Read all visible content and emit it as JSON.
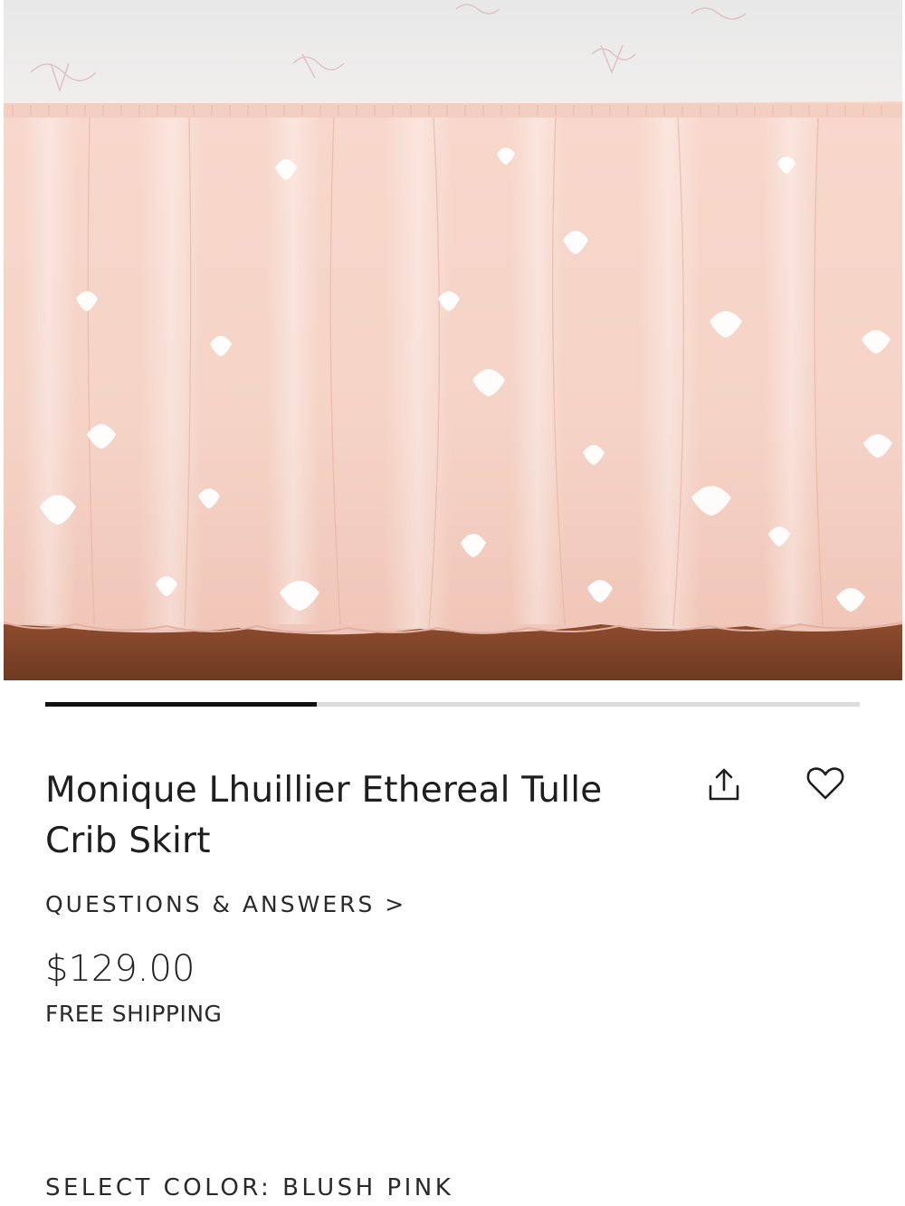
{
  "product": {
    "title": "Monique Lhuillier Ethereal Tulle Crib Skirt",
    "questions_link": "QUESTIONS & ANSWERS >",
    "price": "$129.00",
    "shipping": "FREE SHIPPING",
    "color_selector_label": "SELECT COLOR: BLUSH PINK"
  },
  "gallery": {
    "progress_fraction": 0.333
  },
  "icons": {
    "share": "share-icon",
    "favorite": "heart-icon"
  },
  "colors": {
    "accent": "#111111",
    "track": "#dcdcdc",
    "tulle": "#f6d6ca",
    "sheet": "#eeeceb",
    "floor": "#8a4a2c"
  }
}
